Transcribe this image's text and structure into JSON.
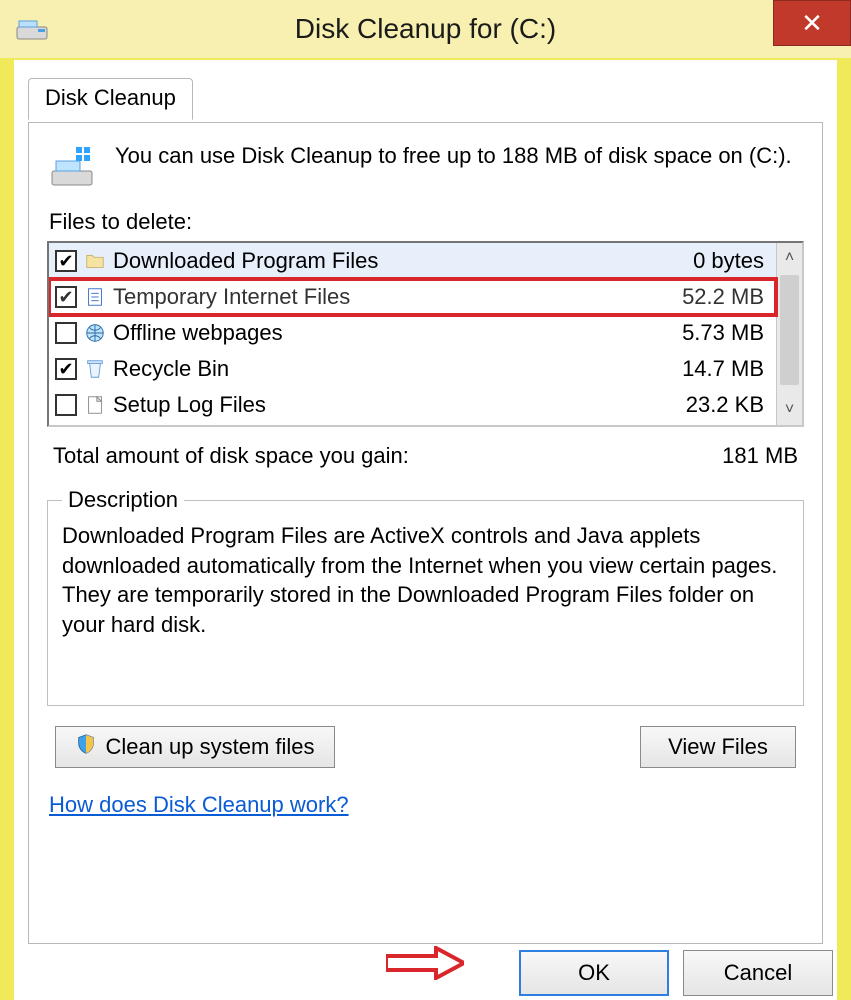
{
  "window": {
    "title": "Disk Cleanup for  (C:)"
  },
  "tab": {
    "label": "Disk Cleanup"
  },
  "intro": {
    "text": "You can use Disk Cleanup to free up to 188 MB of disk space on  (C:)."
  },
  "files_label": "Files to delete:",
  "files": [
    {
      "name": "Downloaded Program Files",
      "size": "0 bytes",
      "checked": true,
      "highlight": false,
      "icon": "folder"
    },
    {
      "name": "Temporary Internet Files",
      "size": "52.2 MB",
      "checked": true,
      "highlight": true,
      "icon": "page"
    },
    {
      "name": "Offline webpages",
      "size": "5.73 MB",
      "checked": false,
      "highlight": false,
      "icon": "globe"
    },
    {
      "name": "Recycle Bin",
      "size": "14.7 MB",
      "checked": true,
      "highlight": false,
      "icon": "bin"
    },
    {
      "name": "Setup Log Files",
      "size": "23.2 KB",
      "checked": false,
      "highlight": false,
      "icon": "file"
    }
  ],
  "total": {
    "label": "Total amount of disk space you gain:",
    "value": "181 MB"
  },
  "description": {
    "legend": "Description",
    "body": "Downloaded Program Files are ActiveX controls and Java applets downloaded automatically from the Internet when you view certain pages. They are temporarily stored in the Downloaded Program Files folder on your hard disk."
  },
  "buttons": {
    "cleanup_system": "Clean up system files",
    "view_files": "View Files",
    "ok": "OK",
    "cancel": "Cancel"
  },
  "link": {
    "label": "How does Disk Cleanup work?"
  }
}
